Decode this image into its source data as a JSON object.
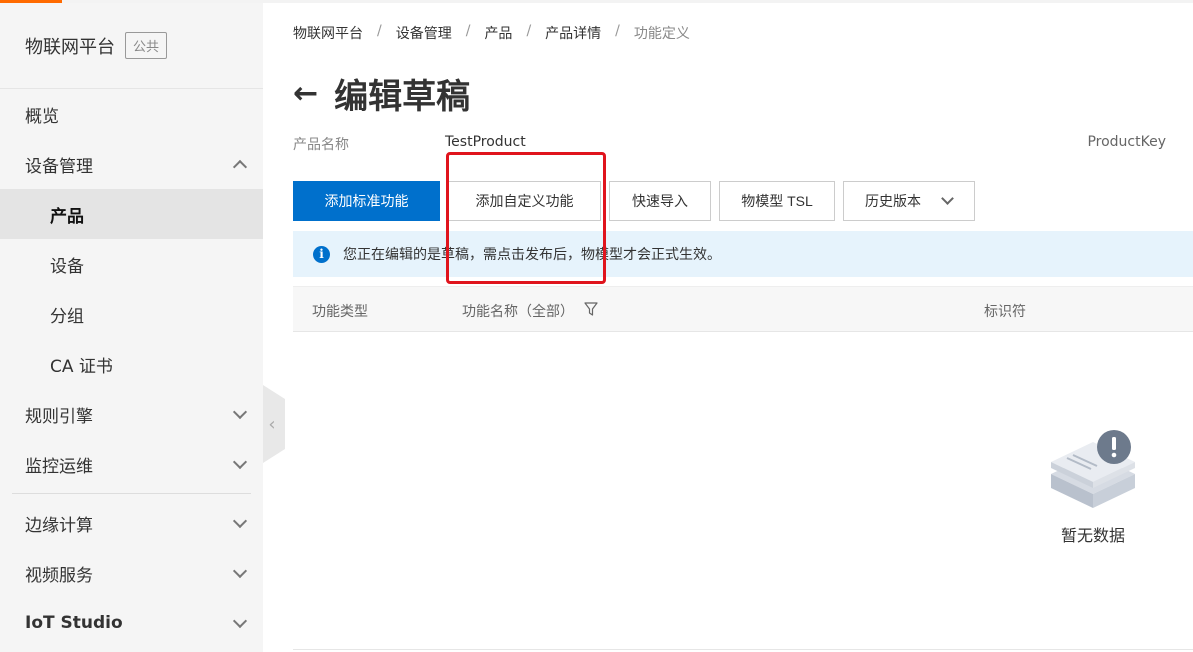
{
  "colors": {
    "accent": "#ff6a00",
    "primary": "#0070cc",
    "highlight": "#e0141d",
    "notice_bg": "#e6f3fc"
  },
  "sidebar": {
    "title": "物联网平台",
    "badge": "公共",
    "items": [
      {
        "label": "概览"
      },
      {
        "label": "设备管理",
        "expanded": true
      },
      {
        "label": "产品",
        "active": true
      },
      {
        "label": "设备"
      },
      {
        "label": "分组"
      },
      {
        "label": "CA 证书"
      },
      {
        "label": "规则引擎"
      },
      {
        "label": "监控运维"
      },
      {
        "label": "边缘计算"
      },
      {
        "label": "视频服务"
      },
      {
        "label": "IoT Studio"
      }
    ]
  },
  "breadcrumb": [
    "物联网平台",
    "设备管理",
    "产品",
    "产品详情",
    "功能定义"
  ],
  "breadcrumb_sep": "/",
  "page": {
    "title": "编辑草稿",
    "product_name_label": "产品名称",
    "product_name_value": "TestProduct",
    "product_key_label": "ProductKey"
  },
  "toolbar": {
    "add_standard": "添加标准功能",
    "add_custom": "添加自定义功能",
    "quick_import": "快速导入",
    "tsl": "物模型 TSL",
    "history": "历史版本"
  },
  "notice": {
    "text": "您正在编辑的是草稿，需点击发布后，物模型才会正式生效。"
  },
  "table": {
    "columns": [
      "功能类型",
      "功能名称（全部）",
      "标识符"
    ]
  },
  "empty": {
    "label": "暂无数据"
  }
}
